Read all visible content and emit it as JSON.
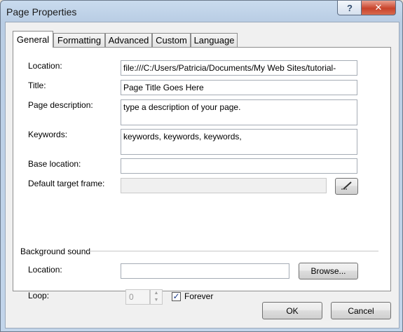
{
  "window": {
    "title": "Page Properties",
    "help_glyph": "?",
    "close_glyph": "✕"
  },
  "tabs": [
    {
      "label": "General",
      "active": true
    },
    {
      "label": "Formatting"
    },
    {
      "label": "Advanced"
    },
    {
      "label": "Custom"
    },
    {
      "label": "Language"
    }
  ],
  "general": {
    "location_label": "Location:",
    "location_value": "file:///C:/Users/Patricia/Documents/My Web Sites/tutorial-",
    "title_label": "Title:",
    "title_value": "Page Title Goes Here",
    "description_label": "Page description:",
    "description_value": "type a description of your page.",
    "keywords_label": "Keywords:",
    "keywords_value": "keywords, keywords, keywords,",
    "base_location_label": "Base location:",
    "base_location_value": "",
    "target_frame_label": "Default target frame:",
    "target_frame_value": "",
    "target_frame_button_icon": "pencil-icon"
  },
  "background_sound": {
    "group_label": "Background sound",
    "location_label": "Location:",
    "location_value": "",
    "browse_label": "Browse...",
    "loop_label": "Loop:",
    "loop_value": "0",
    "forever_label": "Forever",
    "forever_checked": true
  },
  "footer": {
    "ok_label": "OK",
    "cancel_label": "Cancel"
  }
}
